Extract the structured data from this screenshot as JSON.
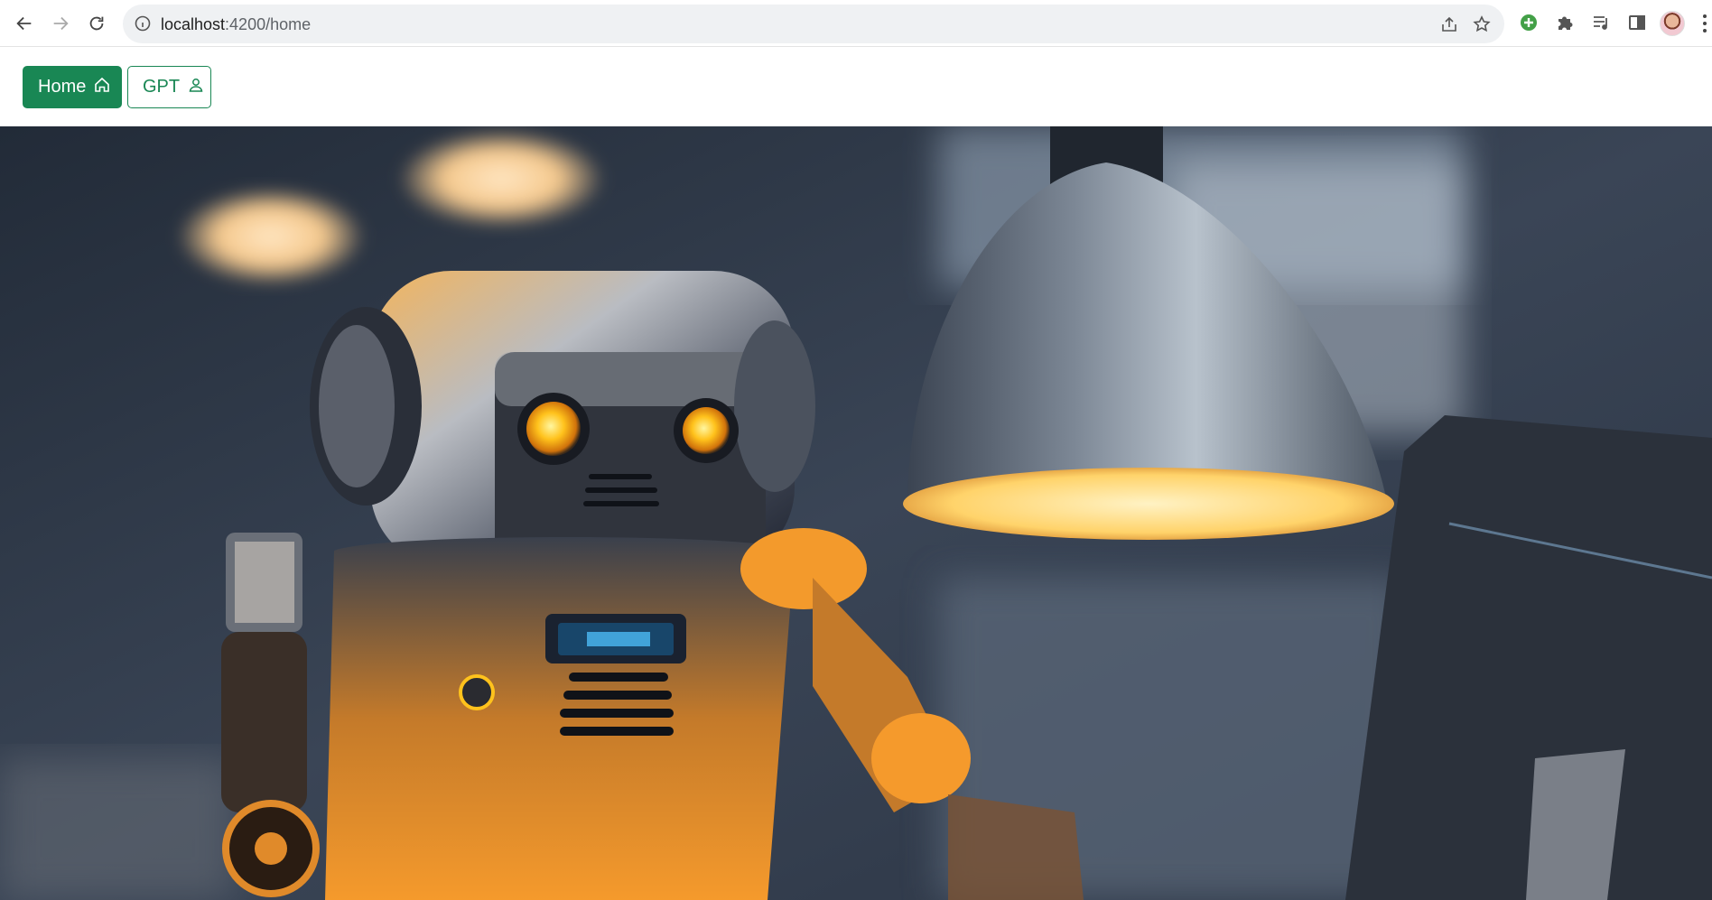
{
  "browser": {
    "url_host": "localhost",
    "url_rest": ":4200/home",
    "icons": [
      "back-arrow-icon",
      "forward-arrow-icon",
      "reload-icon",
      "info-icon",
      "share-icon",
      "star-icon",
      "extension-add-icon",
      "puzzle-icon",
      "media-icon",
      "side-panel-icon",
      "profile-avatar",
      "menu-kebab-icon"
    ]
  },
  "navbar": {
    "home_label": "Home",
    "gpt_label": "GPT",
    "accent": "#198754"
  },
  "hero": {
    "subject": "robot-at-desk-illustration",
    "palette": [
      "#2b3544",
      "#f59a2c",
      "#ffd36a",
      "#5d6a7c"
    ]
  }
}
